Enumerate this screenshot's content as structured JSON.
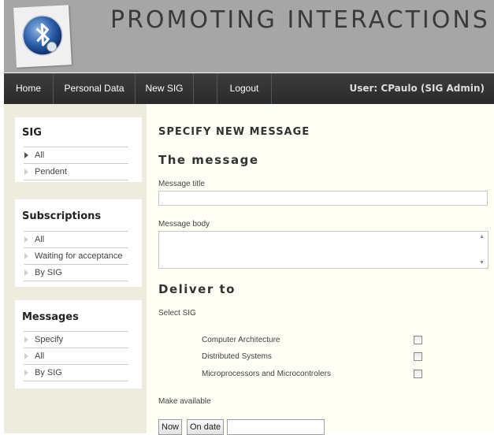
{
  "site": {
    "title": "PROMOTING INTERACTIONS",
    "logo_icon": "bluetooth-logo-icon"
  },
  "nav": {
    "items": [
      "Home",
      "Personal Data",
      "New SIG",
      "Logout"
    ],
    "user": "User: CPaulo (SIG Admin)"
  },
  "sidebar": {
    "sig": {
      "title": "SIG",
      "items": [
        "All",
        "Pendent"
      ]
    },
    "subscriptions": {
      "title": "Subscriptions",
      "items": [
        "All",
        "Waiting for acceptance",
        "By SIG"
      ]
    },
    "messages": {
      "title": "Messages",
      "items": [
        "Specify",
        "All",
        "By SIG"
      ]
    }
  },
  "main": {
    "heading": "SPECIFY NEW MESSAGE",
    "message_section": "The message",
    "title_label": "Message title",
    "title_value": "",
    "body_label": "Message body",
    "body_value": "",
    "deliver_section": "Deliver to",
    "select_sig_label": "Select SIG",
    "sigs": [
      {
        "name": "Computer Architecture",
        "checked": false
      },
      {
        "name": "Distributed Systems",
        "checked": false
      },
      {
        "name": "Microprocessors and Microcontrolers",
        "checked": false
      }
    ],
    "make_available_label": "Make available",
    "now_button": "Now",
    "on_date_button": "On date",
    "date_value": ""
  },
  "colors": {
    "header_bg": "#a6a6a6",
    "nav_bg": "#333333",
    "sidebar_bg": "#eeecdf",
    "content_bg": "#fffef5"
  }
}
